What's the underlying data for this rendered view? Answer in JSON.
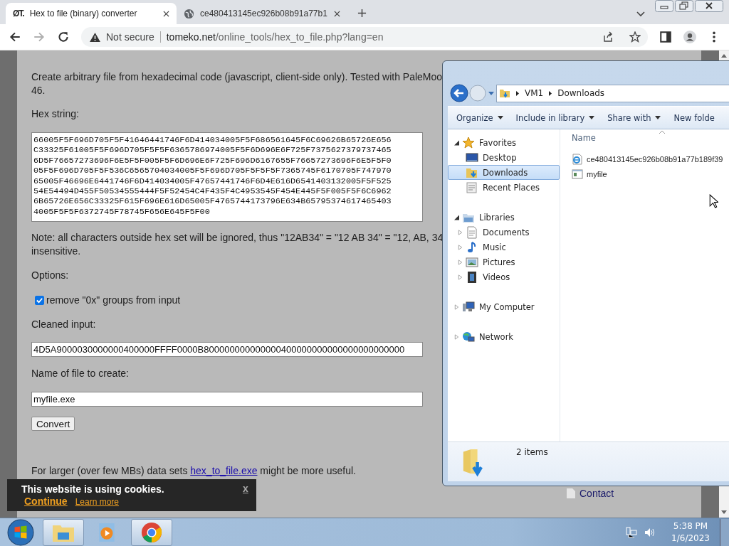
{
  "browser": {
    "tabs": [
      {
        "favicon_text": "ØT.",
        "title": "Hex to file (binary) converter",
        "selected": true
      },
      {
        "title": "ce480413145ec926b08b91a77b1",
        "selected": false
      }
    ],
    "security": "Not secure",
    "url_host": "tomeko.net",
    "url_path": "/online_tools/hex_to_file.php?lang=en"
  },
  "page": {
    "intro_lines": [
      "Create arbitrary file from hexadecimal code (javascript, client-side only). Tested with PaleMoo",
      "46."
    ],
    "hex_label": "Hex string:",
    "hex_lines": [
      "66005F5F696D705F5F41646441746F6D414034005F5F686561645F6C69626B65726E656",
      "C33325F61005F5F696D705F5F5F6365786974005F5F6D696E6F725F7375627379737465",
      "6D5F76657273696F6E5F5F005F5F6D696E6F725F696D6167655F76657273696F6E5F5F0",
      "05F5F696D705F5F536C6565704034005F5F696D705F5F5F5F7365745F6170705F747970",
      "65005F46696E6441746F6D414034005F47657441746F6D4E616D6541403132005F5F525",
      "54E54494D455F50534555444F5F52454C4F435F4C4953545F454E445F5F005F5F6C6962",
      "6B65726E656C33325F615F696E616D65005F4765744173796E634B65795374617465403",
      "4005F5F5F6372745F78745F656E645F5F00"
    ],
    "note_lines": [
      "Note: all characters outside hex set will be ignored, thus \"12AB34\" = \"12 AB 34\" = \"12, AB, 34",
      "insensitive."
    ],
    "options_label": "Options:",
    "remove_0x": {
      "label": "remove \"0x\" groups from input",
      "checked": true
    },
    "cleaned_label": "Cleaned input:",
    "cleaned_value": "4D5A9000030000000400000FFFF0000B800000000000000400000000000000000000000",
    "filename_label": "Name of file to create:",
    "filename_value": "myfile.exe",
    "convert_button": "Convert",
    "footer": {
      "before": "For larger (over few MBs) data sets ",
      "link": "hex_to_file.exe",
      "after": " might be more useful."
    },
    "sidebar_links": [
      "Contact"
    ]
  },
  "cookie_banner": {
    "message": "This website is using cookies.",
    "continue": "Continue",
    "learn_more": "Learn more",
    "close": "x"
  },
  "explorer": {
    "breadcrumb": [
      "VM1",
      "Downloads"
    ],
    "toolbar": [
      {
        "label": "Organize",
        "dropdown": true
      },
      {
        "label": "Include in library",
        "dropdown": true
      },
      {
        "label": "Share with",
        "dropdown": true
      },
      {
        "label": "New folde",
        "dropdown": false
      }
    ],
    "nav": [
      {
        "label": "Favorites",
        "kind": "favorites",
        "expanded": true,
        "selected": false,
        "children": [
          {
            "label": "Desktop",
            "kind": "desktop",
            "selected": false
          },
          {
            "label": "Downloads",
            "kind": "downloads",
            "selected": true
          },
          {
            "label": "Recent Places",
            "kind": "recent",
            "selected": false
          }
        ]
      },
      {
        "label": "Libraries",
        "kind": "libraries",
        "expanded": true,
        "selected": false,
        "children": [
          {
            "label": "Documents",
            "kind": "documents",
            "expanded": false,
            "selected": false
          },
          {
            "label": "Music",
            "kind": "music",
            "expanded": false,
            "selected": false
          },
          {
            "label": "Pictures",
            "kind": "pictures",
            "expanded": false,
            "selected": false
          },
          {
            "label": "Videos",
            "kind": "videos",
            "expanded": false,
            "selected": false
          }
        ]
      },
      {
        "label": "My Computer",
        "kind": "computer",
        "expanded": false,
        "selected": false
      },
      {
        "label": "Network",
        "kind": "network",
        "expanded": false,
        "selected": false
      }
    ],
    "column_header": "Name",
    "files": [
      {
        "name": "ce480413145ec926b08b91a77b189f39",
        "kind": "web"
      },
      {
        "name": "myfile",
        "kind": "app"
      }
    ],
    "status": "2 items"
  },
  "taskbar": {
    "time": "5:38 PM",
    "date": "1/6/2023"
  }
}
